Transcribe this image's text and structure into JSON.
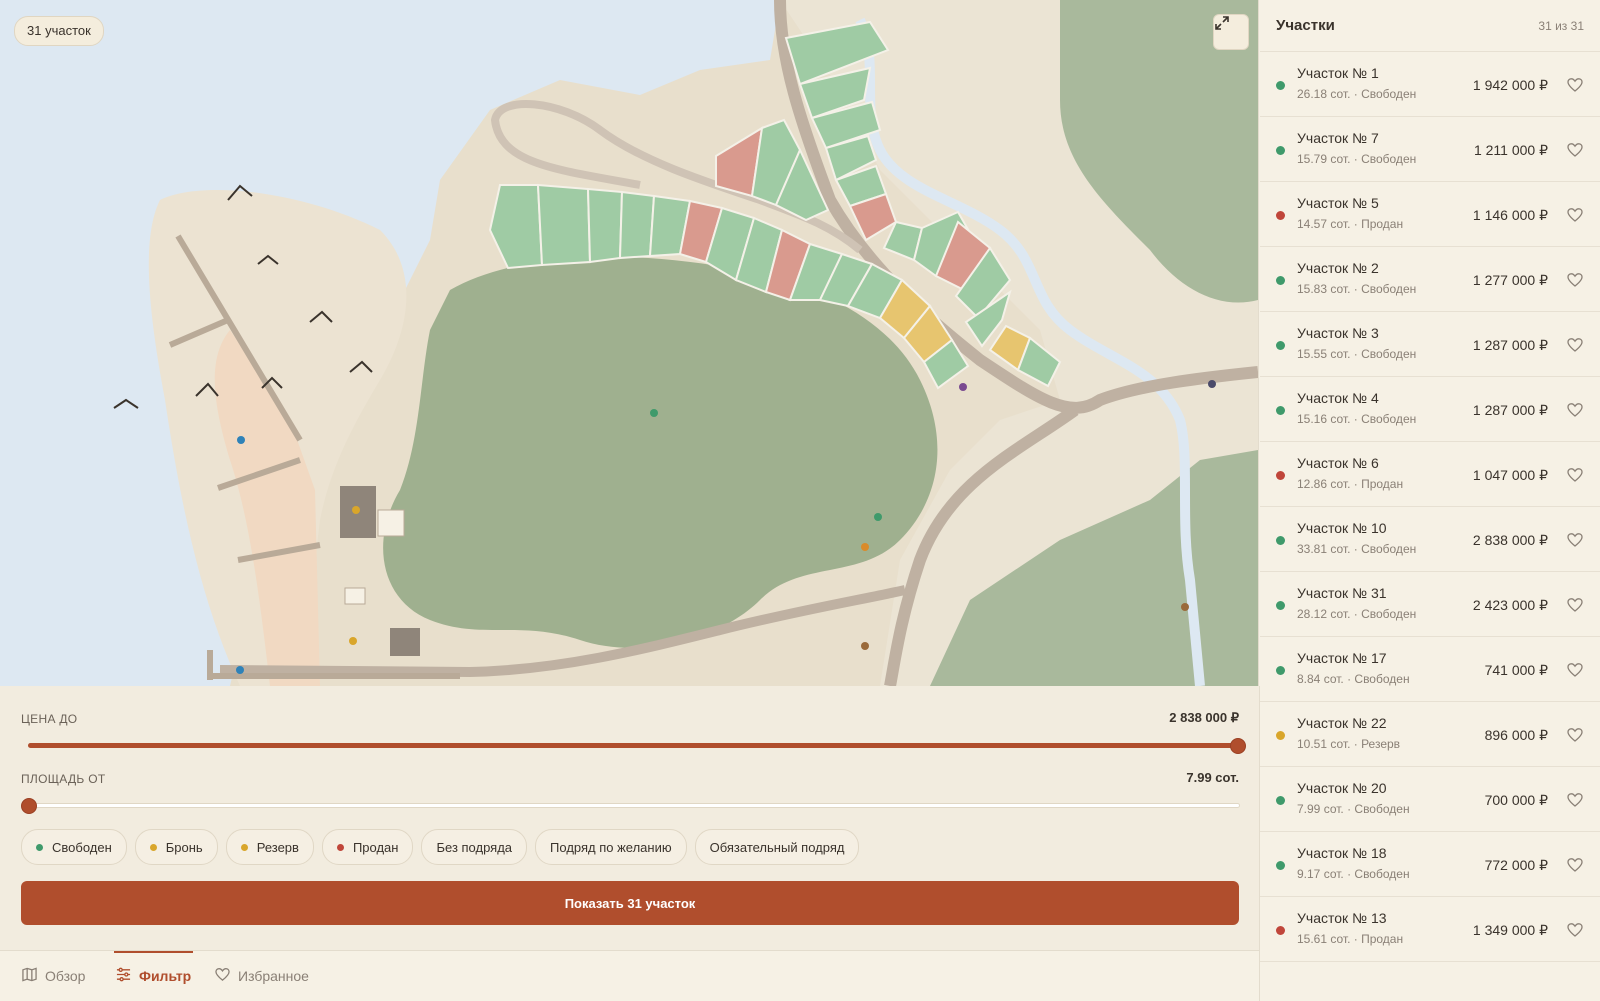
{
  "map": {
    "plot_count_badge": "31 участок",
    "expand_icon": "expand-icon"
  },
  "filters": {
    "price": {
      "label": "ЦЕНА ДО",
      "value": "2 838 000 ₽",
      "fill_fraction": 1.0
    },
    "area": {
      "label": "ПЛОЩАДЬ ОТ",
      "value": "7.99 сот.",
      "fill_fraction": 0.0
    },
    "chips": [
      {
        "label": "Свободен",
        "dot": "#3f9a6b"
      },
      {
        "label": "Бронь",
        "dot": "#d9a62b"
      },
      {
        "label": "Резерв",
        "dot": "#d9a62b"
      },
      {
        "label": "Продан",
        "dot": "#c0463a"
      },
      {
        "label": "Без подряда",
        "dot": ""
      },
      {
        "label": "Подряд по желанию",
        "dot": ""
      },
      {
        "label": "Обязательный подряд",
        "dot": ""
      }
    ],
    "show_button": "Показать 31 участок"
  },
  "bottom_nav": {
    "tabs": [
      {
        "label": "Обзор",
        "icon": "map-icon",
        "active": false
      },
      {
        "label": "Фильтр",
        "icon": "sliders-icon",
        "active": true
      },
      {
        "label": "Избранное",
        "icon": "heart-icon",
        "active": false
      }
    ]
  },
  "panel": {
    "title": "Участки",
    "count": "31 из 31",
    "plots": [
      {
        "name": "Участок № 1",
        "meta": "26.18 сот. · Свободен",
        "price": "1 942 000 ₽",
        "status_color": "#3f9a6b"
      },
      {
        "name": "Участок № 7",
        "meta": "15.79 сот. · Свободен",
        "price": "1 211 000 ₽",
        "status_color": "#3f9a6b"
      },
      {
        "name": "Участок № 5",
        "meta": "14.57 сот. · Продан",
        "price": "1 146 000 ₽",
        "status_color": "#c0463a"
      },
      {
        "name": "Участок № 2",
        "meta": "15.83 сот. · Свободен",
        "price": "1 277 000 ₽",
        "status_color": "#3f9a6b"
      },
      {
        "name": "Участок № 3",
        "meta": "15.55 сот. · Свободен",
        "price": "1 287 000 ₽",
        "status_color": "#3f9a6b"
      },
      {
        "name": "Участок № 4",
        "meta": "15.16 сот. · Свободен",
        "price": "1 287 000 ₽",
        "status_color": "#3f9a6b"
      },
      {
        "name": "Участок № 6",
        "meta": "12.86 сот. · Продан",
        "price": "1 047 000 ₽",
        "status_color": "#c0463a"
      },
      {
        "name": "Участок № 10",
        "meta": "33.81 сот. · Свободен",
        "price": "2 838 000 ₽",
        "status_color": "#3f9a6b"
      },
      {
        "name": "Участок № 31",
        "meta": "28.12 сот. · Свободен",
        "price": "2 423 000 ₽",
        "status_color": "#3f9a6b"
      },
      {
        "name": "Участок № 17",
        "meta": "8.84 сот. · Свободен",
        "price": "741 000 ₽",
        "status_color": "#3f9a6b"
      },
      {
        "name": "Участок № 22",
        "meta": "10.51 сот. · Резерв",
        "price": "896 000 ₽",
        "status_color": "#d9a62b"
      },
      {
        "name": "Участок № 20",
        "meta": "7.99 сот. · Свободен",
        "price": "700 000 ₽",
        "status_color": "#3f9a6b"
      },
      {
        "name": "Участок № 18",
        "meta": "9.17 сот. · Свободен",
        "price": "772 000 ₽",
        "status_color": "#3f9a6b"
      },
      {
        "name": "Участок № 13",
        "meta": "15.61 сот. · Продан",
        "price": "1 349 000 ₽",
        "status_color": "#c0463a"
      }
    ]
  },
  "colors": {
    "accent": "#b04e2d",
    "free": "#3f9a6b",
    "reserve": "#d9a62b",
    "sold": "#c0463a",
    "plot_free_fill": "#9fcba4",
    "plot_sold_fill": "#d99a8e",
    "plot_reserve_fill": "#e7c56f"
  }
}
